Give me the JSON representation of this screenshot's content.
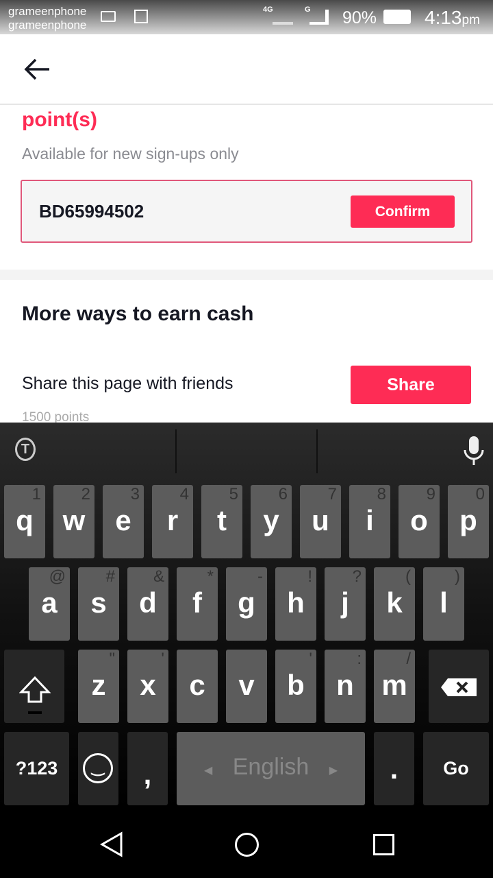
{
  "status_bar": {
    "carrier_1": "grameenphone",
    "carrier_2": "grameenphone",
    "network_1": "4G",
    "network_2": "G",
    "battery": "90%",
    "time": "4:13",
    "time_suffix": "pm",
    "icons": [
      "keyboard-icon",
      "image-icon",
      "signal-icon",
      "battery-icon"
    ]
  },
  "header": {
    "back_icon": "arrow-left-icon"
  },
  "referral": {
    "title_fragment": "point(s)",
    "subtitle": "Available for new sign-ups only",
    "code_value": "BD65994502",
    "confirm_label": "Confirm"
  },
  "earn": {
    "heading": "More ways to earn cash",
    "share_text": "Share this page with friends",
    "share_label": "Share",
    "share_points": "1500 points"
  },
  "keyboard": {
    "row1": [
      [
        "q",
        "1"
      ],
      [
        "w",
        "2"
      ],
      [
        "e",
        "3"
      ],
      [
        "r",
        "4"
      ],
      [
        "t",
        "5"
      ],
      [
        "y",
        "6"
      ],
      [
        "u",
        "7"
      ],
      [
        "i",
        "8"
      ],
      [
        "o",
        "9"
      ],
      [
        "p",
        "0"
      ]
    ],
    "row2": [
      [
        "a",
        "@"
      ],
      [
        "s",
        "#"
      ],
      [
        "d",
        "&"
      ],
      [
        "f",
        "*"
      ],
      [
        "g",
        "-"
      ],
      [
        "h",
        "!"
      ],
      [
        "j",
        "?"
      ],
      [
        "k",
        "("
      ],
      [
        "l",
        ")"
      ]
    ],
    "row3": [
      [
        "z",
        "\""
      ],
      [
        "x",
        "'"
      ],
      [
        "c",
        ""
      ],
      [
        "v",
        ""
      ],
      [
        "b",
        "'"
      ],
      [
        "n",
        ":"
      ],
      [
        "m",
        "/"
      ]
    ],
    "symbols_label": "?123",
    "comma": ",",
    "period": ".",
    "space_label": "English",
    "go_label": "Go"
  },
  "colors": {
    "accent": "#fe2c55"
  }
}
